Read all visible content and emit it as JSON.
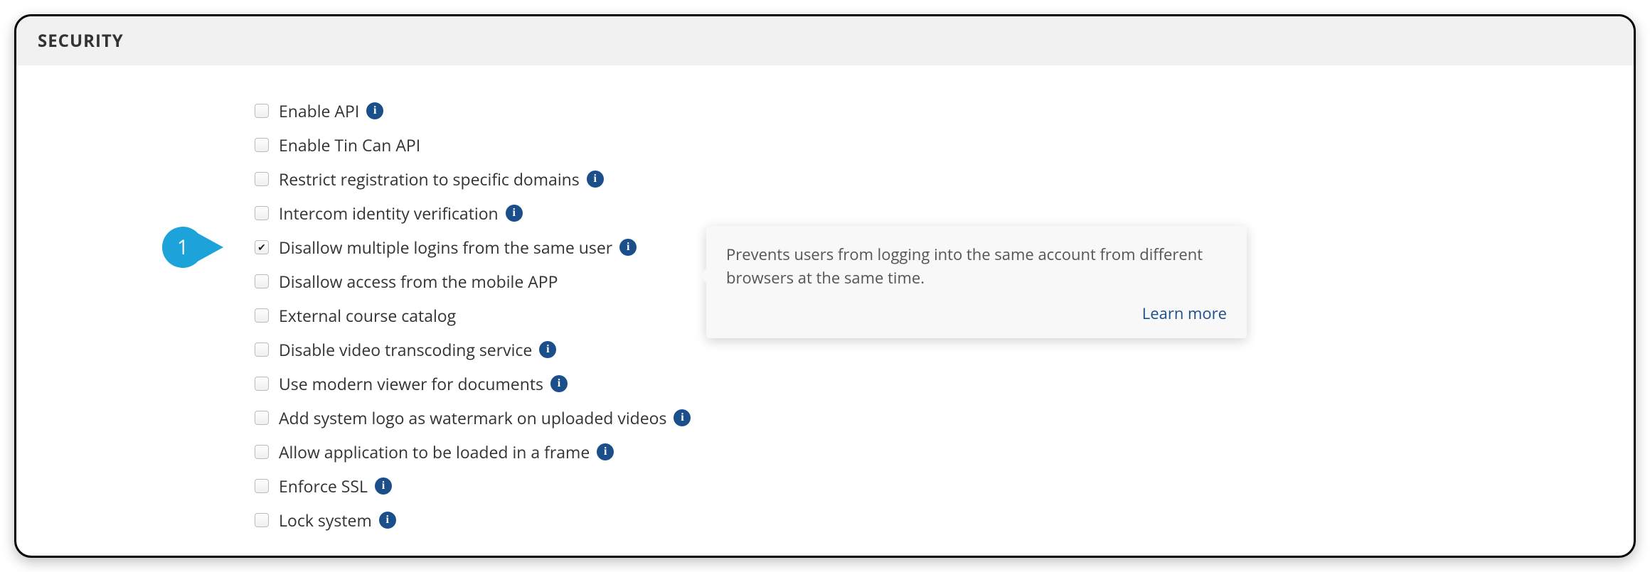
{
  "section": {
    "title": "SECURITY"
  },
  "callout": {
    "number": "1"
  },
  "options": [
    {
      "id": "enable-api",
      "label": "Enable API",
      "checked": false,
      "info": true
    },
    {
      "id": "enable-tincan",
      "label": "Enable Tin Can API",
      "checked": false,
      "info": false
    },
    {
      "id": "restrict-domains",
      "label": "Restrict registration to specific domains",
      "checked": false,
      "info": true
    },
    {
      "id": "intercom-identity",
      "label": "Intercom identity verification",
      "checked": false,
      "info": true
    },
    {
      "id": "disallow-multiple-logins",
      "label": "Disallow multiple logins from the same user",
      "checked": true,
      "info": true,
      "callout": true
    },
    {
      "id": "disallow-mobile",
      "label": "Disallow access from the mobile APP",
      "checked": false,
      "info": false
    },
    {
      "id": "external-catalog",
      "label": "External course catalog",
      "checked": false,
      "info": false
    },
    {
      "id": "disable-transcoding",
      "label": "Disable video transcoding service",
      "checked": false,
      "info": true
    },
    {
      "id": "modern-viewer",
      "label": "Use modern viewer for documents",
      "checked": false,
      "info": true
    },
    {
      "id": "watermark-videos",
      "label": "Add system logo as watermark on uploaded videos",
      "checked": false,
      "info": true
    },
    {
      "id": "allow-frame",
      "label": "Allow application to be loaded in a frame",
      "checked": false,
      "info": true
    },
    {
      "id": "enforce-ssl",
      "label": "Enforce SSL",
      "checked": false,
      "info": true
    },
    {
      "id": "lock-system",
      "label": "Lock system",
      "checked": false,
      "info": true
    }
  ],
  "tooltip": {
    "text": "Prevents users from logging into the same account from different browsers at the same time.",
    "link_label": "Learn more"
  }
}
